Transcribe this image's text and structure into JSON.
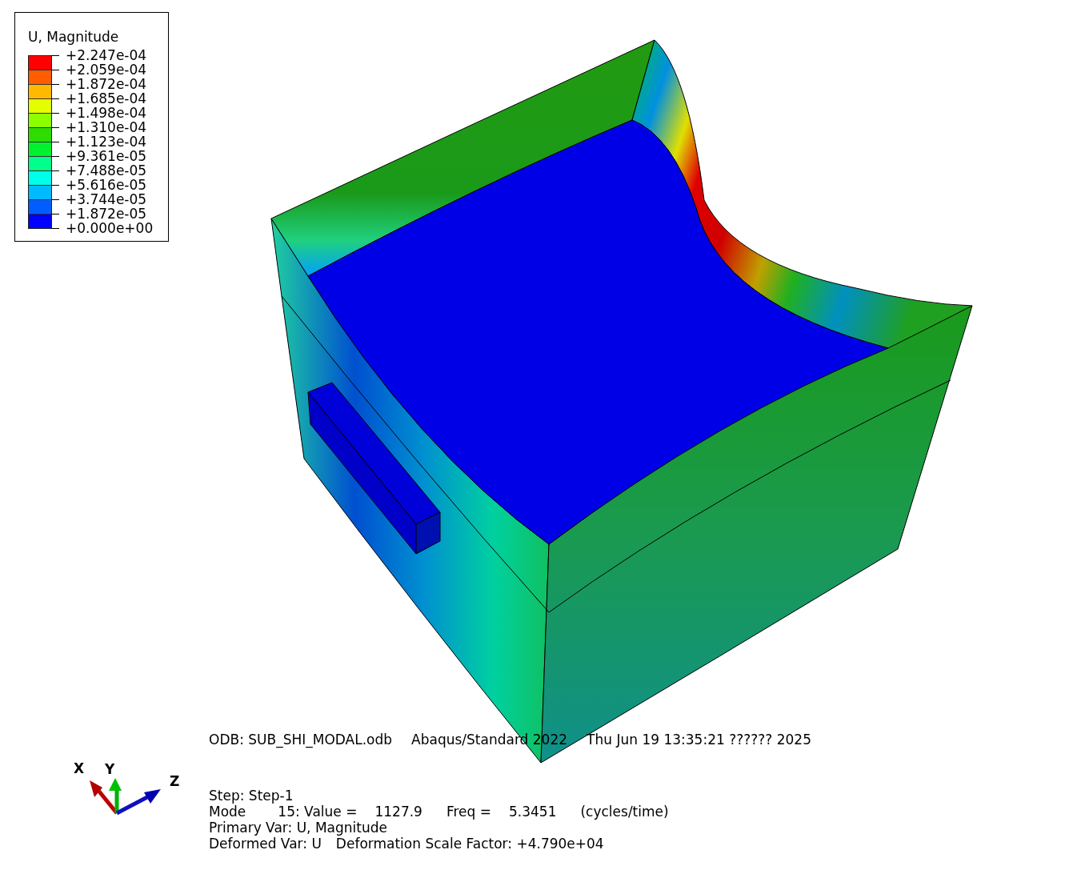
{
  "legend": {
    "title": "U, Magnitude",
    "bands": [
      {
        "color": "#ff0000"
      },
      {
        "color": "#ff5d00"
      },
      {
        "color": "#ffb900"
      },
      {
        "color": "#e3ff00"
      },
      {
        "color": "#8cff00"
      },
      {
        "color": "#2edc00"
      },
      {
        "color": "#00f22e"
      },
      {
        "color": "#00ff8b"
      },
      {
        "color": "#00ffe8"
      },
      {
        "color": "#00b9ff"
      },
      {
        "color": "#005dff"
      },
      {
        "color": "#0000ff"
      }
    ],
    "ticks": [
      "+2.247e-04",
      "+2.059e-04",
      "+1.872e-04",
      "+1.685e-04",
      "+1.498e-04",
      "+1.310e-04",
      "+1.123e-04",
      "+9.361e-05",
      "+7.488e-05",
      "+5.616e-05",
      "+3.744e-05",
      "+1.872e-05",
      "+0.000e+00"
    ]
  },
  "triad": {
    "x_label": "X",
    "y_label": "Y",
    "z_label": "Z"
  },
  "header_line": [
    "ODB: SUB_SHI_MODAL.odb",
    "Abaqus/Standard 2022",
    "Thu Jun 19 13:35:21 ?????? 2025"
  ],
  "info_lines": [
    [
      "Step: Step-1"
    ],
    [
      "Mode",
      "15: Value =",
      "1127.9",
      "Freq =",
      "5.3451",
      "(cycles/time)"
    ],
    [
      "Primary Var: U, Magnitude"
    ],
    [
      "Deformed Var: U",
      "Deformation Scale Factor: +4.790e+04"
    ]
  ]
}
